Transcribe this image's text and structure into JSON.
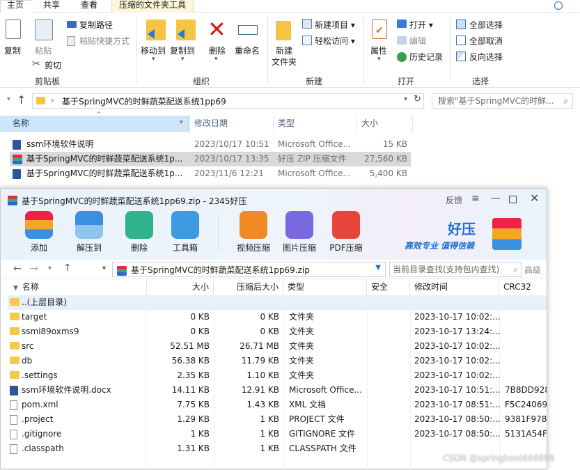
{
  "explorer": {
    "tabs": [
      "主页",
      "共享",
      "查看",
      "压缩的文件夹工具"
    ],
    "ribbon": {
      "clipboard": {
        "copy": "复制",
        "paste": "粘贴",
        "copy_path": "复制路径",
        "paste_shortcut": "粘贴快捷方式",
        "cut": "剪切",
        "label": "剪贴板"
      },
      "organize": {
        "move_to": "移动到",
        "copy_to": "复制到",
        "delete": "删除",
        "rename": "重命名",
        "label": "组织"
      },
      "new": {
        "new_folder": "新建\n文件夹",
        "new_folder_1": "新建",
        "new_folder_2": "文件夹",
        "new_item": "新建项目",
        "easy_access": "轻松访问",
        "label": "新建"
      },
      "open": {
        "properties": "属性",
        "open": "打开",
        "edit": "编辑",
        "history": "历史记录",
        "label": "打开"
      },
      "select": {
        "select_all": "全部选择",
        "select_none": "全部取消",
        "invert": "反向选择",
        "label": "选择"
      }
    },
    "path": "基于SpringMVC的时鲜蔬菜配送系统1pp69",
    "search_placeholder": "搜索\"基于SpringMVC的时鲜...",
    "columns": [
      "名称",
      "修改日期",
      "类型",
      "大小"
    ],
    "files": [
      {
        "name": "ssm环境软件说明",
        "date": "2023/10/17 10:51",
        "type": "Microsoft Office...",
        "size": "15 KB"
      },
      {
        "name": "基于SpringMVC的时鲜蔬菜配送系统1p...",
        "date": "2023/10/17 13:35",
        "type": "好压 ZIP 压缩文件",
        "size": "27,560 KB"
      },
      {
        "name": "基于SpringMVC的时鲜蔬菜配送系统1p...",
        "date": "2023/11/6 12:21",
        "type": "Microsoft Office...",
        "size": "5,400 KB"
      }
    ]
  },
  "zip": {
    "title": "基于SpringMVC的时鲜蔬菜配送系统1pp69.zip - 2345好压",
    "feedback": "反馈",
    "toolbar": [
      "添加",
      "解压到",
      "删除",
      "工具箱",
      "视频压缩",
      "图片压缩",
      "PDF压缩"
    ],
    "brand": "好压",
    "slogan": "高效专业 值得信赖",
    "path": "基于SpringMVC的时鲜蔬菜配送系统1pp69.zip",
    "search_placeholder": "当前目录查找(支持包内查找)",
    "advanced": "高级",
    "columns": [
      "名称",
      "大小",
      "压缩后大小",
      "类型",
      "安全",
      "修改时间",
      "CRC32"
    ],
    "rows": [
      {
        "name": "..(上层目录)",
        "size": "",
        "packed": "",
        "type": "",
        "time": "",
        "crc": "",
        "kind": "folder"
      },
      {
        "name": "target",
        "size": "0 KB",
        "packed": "0 KB",
        "type": "文件夹",
        "time": "2023-10-17 10:02:...",
        "crc": "",
        "kind": "folder"
      },
      {
        "name": "ssmi89oxms9",
        "size": "0 KB",
        "packed": "0 KB",
        "type": "文件夹",
        "time": "2023-10-17 13:24:...",
        "crc": "",
        "kind": "folder"
      },
      {
        "name": "src",
        "size": "52.51 MB",
        "packed": "26.71 MB",
        "type": "文件夹",
        "time": "2023-10-17 10:02:...",
        "crc": "",
        "kind": "folder"
      },
      {
        "name": "db",
        "size": "56.38 KB",
        "packed": "11.79 KB",
        "type": "文件夹",
        "time": "2023-10-17 10:02:...",
        "crc": "",
        "kind": "folder"
      },
      {
        "name": ".settings",
        "size": "2.35 KB",
        "packed": "1.10 KB",
        "type": "文件夹",
        "time": "2023-10-17 10:02:...",
        "crc": "",
        "kind": "folder"
      },
      {
        "name": "ssm环境软件说明.docx",
        "size": "14.11 KB",
        "packed": "12.91 KB",
        "type": "Microsoft Office...",
        "time": "2023-10-17 10:51:...",
        "crc": "7B8DD928",
        "kind": "docx"
      },
      {
        "name": "pom.xml",
        "size": "7.75 KB",
        "packed": "1.43 KB",
        "type": "XML 文档",
        "time": "2023-10-17 08:51:...",
        "crc": "F5C24069",
        "kind": "file"
      },
      {
        "name": ".project",
        "size": "1.29 KB",
        "packed": "1 KB",
        "type": "PROJECT 文件",
        "time": "2023-10-17 08:50:...",
        "crc": "9381F978",
        "kind": "file"
      },
      {
        "name": ".gitignore",
        "size": "1 KB",
        "packed": "1 KB",
        "type": "GITIGNORE 文件",
        "time": "2023-10-17 08:50:...",
        "crc": "5131A54F",
        "kind": "file"
      },
      {
        "name": ".classpath",
        "size": "1.31 KB",
        "packed": "1 KB",
        "type": "CLASSPATH 文件",
        "time": "",
        "crc": "",
        "kind": "file"
      }
    ]
  },
  "watermark": "CSDN @springboot666888"
}
